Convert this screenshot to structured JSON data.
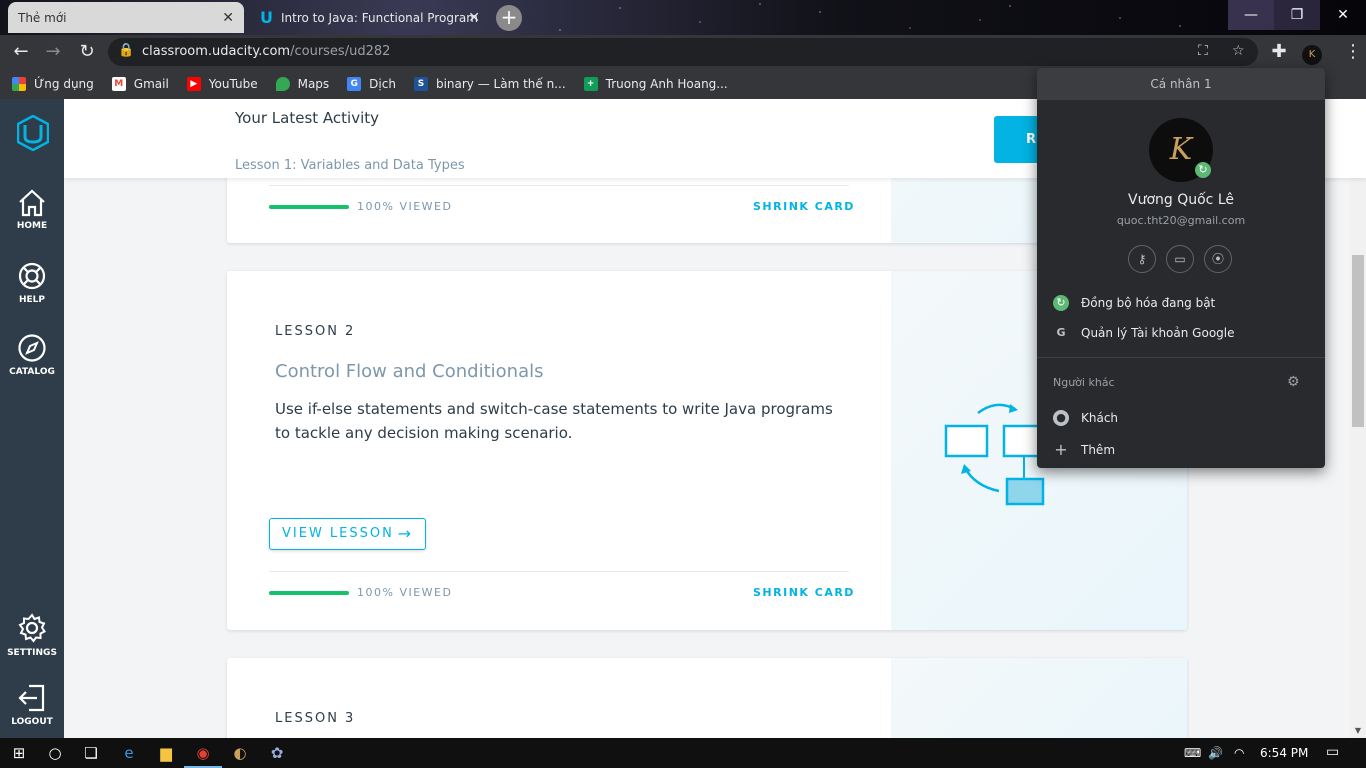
{
  "browser": {
    "tabs": [
      {
        "title": "Thẻ mới"
      },
      {
        "title": "Intro to Java: Functional Program"
      }
    ],
    "url_domain": "classroom.udacity.com",
    "url_path": "/courses/ud282",
    "bookmarks": [
      {
        "label": "Ứng dụng",
        "icon": "apps-icon"
      },
      {
        "label": "Gmail",
        "icon": "gmail-icon"
      },
      {
        "label": "YouTube",
        "icon": "youtube-icon"
      },
      {
        "label": "Maps",
        "icon": "maps-icon"
      },
      {
        "label": "Dịch",
        "icon": "translate-icon"
      },
      {
        "label": "binary — Làm thế n...",
        "icon": "stackexchange-icon"
      },
      {
        "label": "Truong Anh Hoang...",
        "icon": "sheets-icon"
      }
    ]
  },
  "sidebar": {
    "items": [
      {
        "label": "HOME"
      },
      {
        "label": "HELP"
      },
      {
        "label": "CATALOG"
      },
      {
        "label": "SETTINGS"
      },
      {
        "label": "LOGOUT"
      }
    ]
  },
  "activity": {
    "title": "Your Latest Activity",
    "lesson": "Lesson 1: Variables and Data Types",
    "button_label": "R"
  },
  "cards": [
    {
      "progress_text": "100% VIEWED",
      "shrink_label": "SHRINK CARD"
    },
    {
      "lesson_label": "LESSON 2",
      "title": "Control Flow and Conditionals",
      "description": "Use if-else statements and switch-case statements to write Java programs to tackle any decision making scenario.",
      "view_label": "VIEW LESSON",
      "progress_text": "100% VIEWED",
      "shrink_label": "SHRINK CARD"
    },
    {
      "lesson_label": "LESSON 3"
    }
  ],
  "profile": {
    "header": "Cá nhân 1",
    "avatar_letter": "K",
    "name": "Vương Quốc Lê",
    "email": "quoc.tht20@gmail.com",
    "sync_label": "Đồng bộ hóa đang bật",
    "manage_label": "Quản lý Tài khoản Google",
    "others_label": "Người khác",
    "guest_label": "Khách",
    "add_label": "Thêm"
  },
  "taskbar": {
    "time": "6:54 PM"
  },
  "colors": {
    "accent": "#02b3e4",
    "sidebar": "#2e3d49",
    "progress": "#15c26b"
  }
}
